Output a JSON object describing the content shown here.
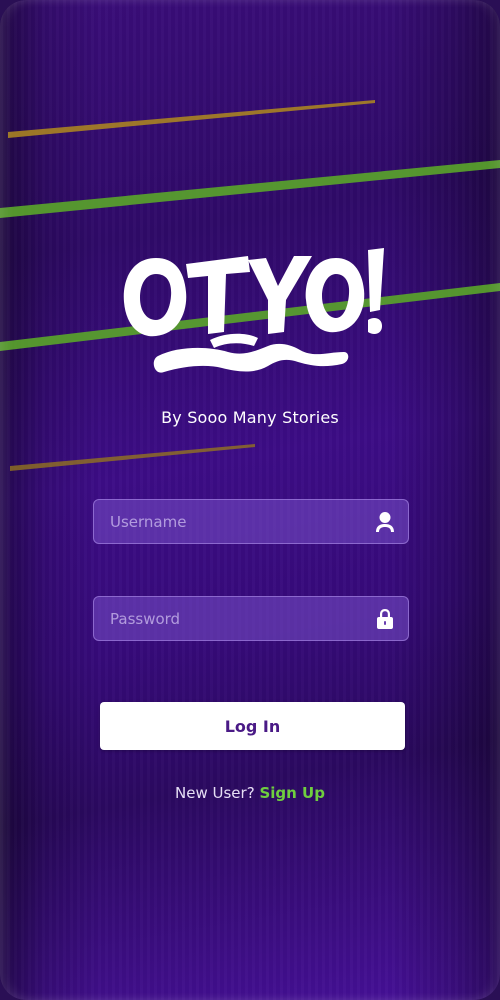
{
  "app": {
    "logo_text": "OTYO!",
    "tagline": "By Sooo Many Stories"
  },
  "login_form": {
    "username": {
      "placeholder": "Username",
      "value": "",
      "icon": "user-icon"
    },
    "password": {
      "placeholder": "Password",
      "value": "",
      "icon": "lock-icon"
    },
    "submit_label": "Log In"
  },
  "signup": {
    "prompt": "New User?",
    "link_label": "Sign Up"
  },
  "colors": {
    "background": "#33096f",
    "field_fill": "#7a52c8",
    "button_text": "#4a1a86",
    "accent_green": "#6fcf3f",
    "stripe_gold": "#b08a1e",
    "stripe_green": "#5aa52a"
  }
}
